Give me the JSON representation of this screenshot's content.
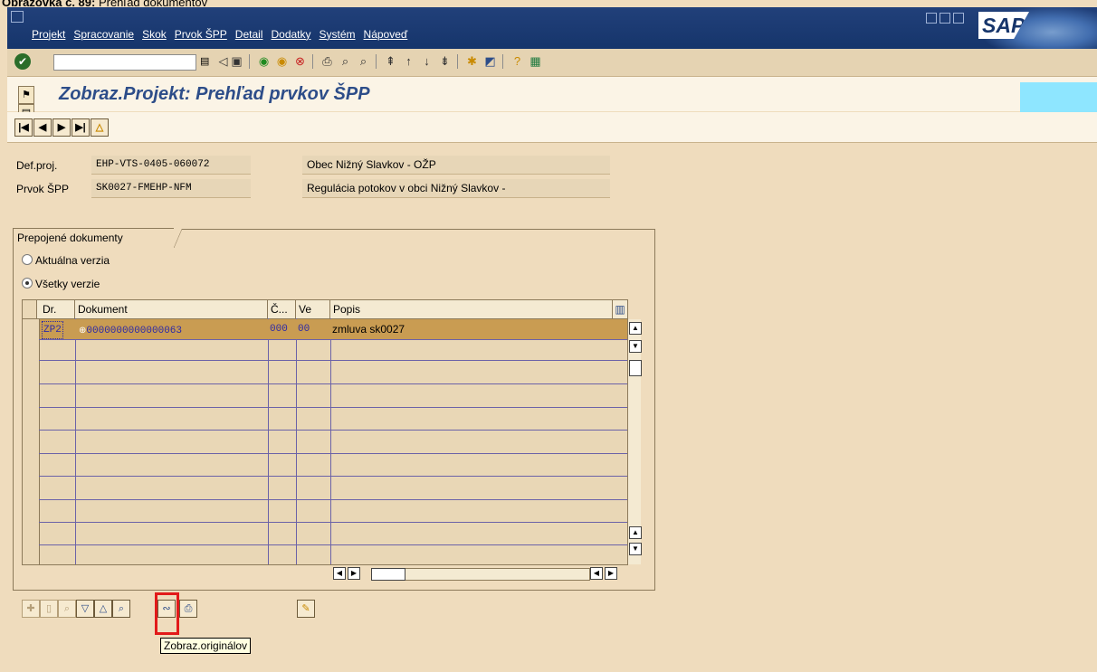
{
  "caption": {
    "bold": "Obrazovka č. 89:",
    "text": "Prehľad dokumentov"
  },
  "menu": [
    "Projekt",
    "Spracovanie",
    "Skok",
    "Prvok ŠPP",
    "Detail",
    "Dodatky",
    "Systém",
    "Nápoveď"
  ],
  "logo": "SAP",
  "title": "Zobraz.Projekt: Prehľad prvkov ŠPP",
  "header": {
    "defproj_label": "Def.proj.",
    "defproj_value": "EHP-VTS-0405-060072",
    "defproj_desc": "Obec Nižný Slavkov - OŽP",
    "prvok_label": "Prvok ŠPP",
    "prvok_value": "SK0027-FMEHP-NFM",
    "prvok_desc": "Regulácia potokov v obci Nižný Slavkov -"
  },
  "frame": {
    "title": "Prepojené dokumenty",
    "radio_current": "Aktuálna verzia",
    "radio_all": "Všetky verzie"
  },
  "table": {
    "columns": [
      "Dr.",
      "Dokument",
      "Č...",
      "Ve",
      "Popis"
    ],
    "rows": [
      {
        "dr": "ZP2",
        "dokument": "0000000000000063",
        "c": "000",
        "ve": "00",
        "popis": "zmluva sk0027"
      }
    ]
  },
  "tooltip": "Zobraz.originálov",
  "colors": {
    "menubar": "#16356b",
    "background": "#efdcbd",
    "selected_row": "#c99c52",
    "highlight": "#e21a1a"
  }
}
